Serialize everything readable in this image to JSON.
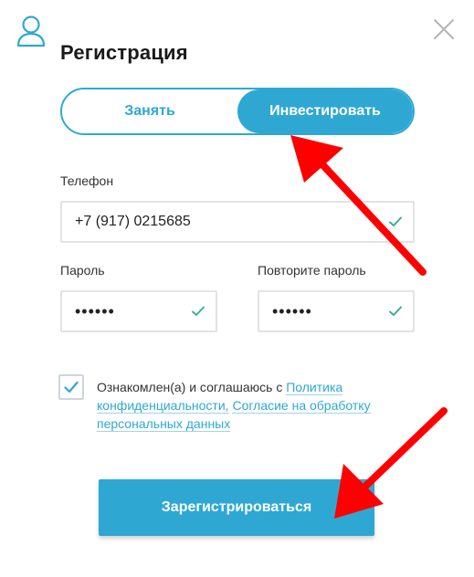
{
  "header": {
    "title": "Регистрация",
    "user_icon": "user-icon",
    "close_icon": "close-icon"
  },
  "mode_toggle": {
    "options": [
      "Занять",
      "Инвестировать"
    ],
    "selected": "Инвестировать"
  },
  "form": {
    "phone": {
      "label": "Телефон",
      "value": "+7 (917) 0215685",
      "valid": true
    },
    "password": {
      "label": "Пароль",
      "value": "••••••",
      "valid": true
    },
    "password_repeat": {
      "label": "Повторите пароль",
      "value": "••••••",
      "valid": true
    }
  },
  "consent": {
    "checked": true,
    "text": "Ознакомлен(а) и соглашаюсь с ",
    "link_privacy": "Политика конфиденциальности,",
    "link_consent": "Согласие на обработку персональных данных"
  },
  "submit": {
    "label": "Зарегистрироваться"
  },
  "colors": {
    "accent": "#2ea8d3",
    "valid_check": "#3bb08f",
    "annotation_arrow": "#ff0000"
  }
}
